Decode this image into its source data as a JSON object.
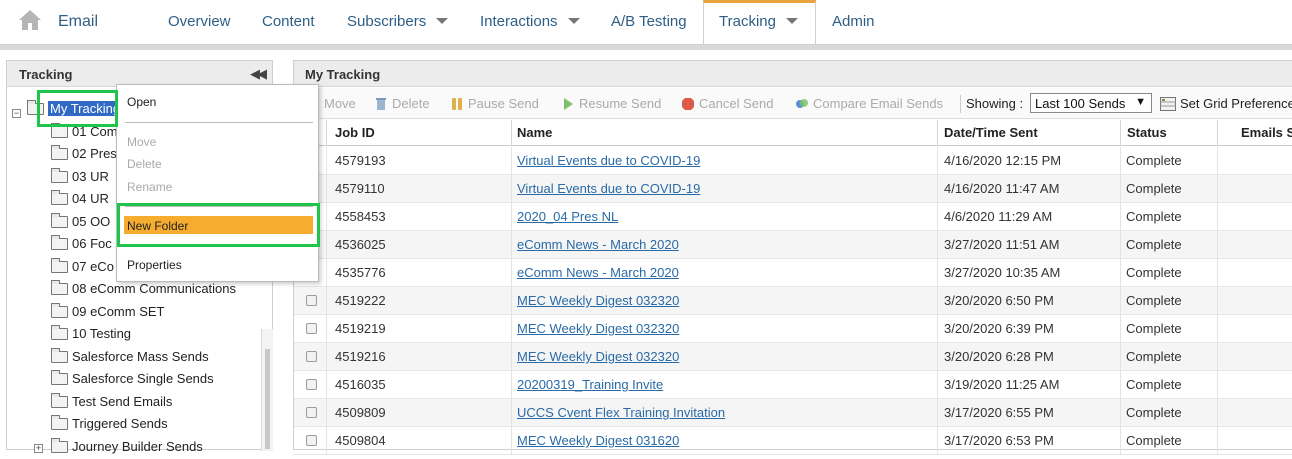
{
  "nav": {
    "app_title": "Email",
    "items": [
      {
        "label": "Overview",
        "has_caret": false
      },
      {
        "label": "Content",
        "has_caret": false
      },
      {
        "label": "Subscribers",
        "has_caret": true
      },
      {
        "label": "Interactions",
        "has_caret": true
      },
      {
        "label": "A/B Testing",
        "has_caret": false
      },
      {
        "label": "Tracking",
        "has_caret": true,
        "active": true
      },
      {
        "label": "Admin",
        "has_caret": false
      }
    ]
  },
  "left": {
    "title": "Tracking",
    "collapse_icon": "double-chevron-left-icon",
    "tree": {
      "root": "My Tracking",
      "folders": [
        "01 Com",
        "02 Pres",
        "03 UR",
        "04 UR",
        "05 OO",
        "06 Foc",
        "07 eCo",
        "08 eComm Communications",
        "09 eComm SET",
        "10 Testing",
        "Salesforce Mass Sends",
        "Salesforce Single Sends",
        "Test Send Emails",
        "Triggered Sends",
        "Journey Builder Sends"
      ]
    }
  },
  "context_menu": {
    "items": [
      {
        "label": "Open",
        "disabled": false
      },
      {
        "label": "Move",
        "disabled": true
      },
      {
        "label": "Delete",
        "disabled": true
      },
      {
        "label": "Rename",
        "disabled": true
      },
      {
        "label": "New Folder",
        "disabled": false,
        "highlighted": true
      },
      {
        "label": "Properties",
        "disabled": false
      }
    ],
    "highlight_color": "#f5ac2f",
    "annotation_color": "#1fc44a"
  },
  "right": {
    "title": "My Tracking",
    "toolbar": {
      "move": "Move",
      "delete": "Delete",
      "pause": "Pause Send",
      "resume": "Resume Send",
      "cancel": "Cancel Send",
      "compare": "Compare Email Sends",
      "showing_label": "Showing :",
      "showing_value": "Last 100 Sends",
      "set_grid": "Set Grid Preferences"
    },
    "columns": [
      "Job ID",
      "Name",
      "Date/Time Sent",
      "Status",
      "Emails Sent"
    ],
    "rows": [
      {
        "job_id": "4579193",
        "name": "Virtual Events due to COVID-19",
        "sent": "4/16/2020 12:15 PM",
        "status": "Complete"
      },
      {
        "job_id": "4579110",
        "name": "Virtual Events due to COVID-19",
        "sent": "4/16/2020 11:47 AM",
        "status": "Complete"
      },
      {
        "job_id": "4558453",
        "name": "2020_04 Pres NL",
        "sent": "4/6/2020 11:29 AM",
        "status": "Complete"
      },
      {
        "job_id": "4536025",
        "name": "eComm News - March 2020",
        "sent": "3/27/2020 11:51 AM",
        "status": "Complete"
      },
      {
        "job_id": "4535776",
        "name": "eComm News - March 2020",
        "sent": "3/27/2020 10:35 AM",
        "status": "Complete"
      },
      {
        "job_id": "4519222",
        "name": "MEC Weekly Digest 032320",
        "sent": "3/20/2020 6:50 PM",
        "status": "Complete"
      },
      {
        "job_id": "4519219",
        "name": "MEC Weekly Digest 032320",
        "sent": "3/20/2020 6:39 PM",
        "status": "Complete"
      },
      {
        "job_id": "4519216",
        "name": "MEC Weekly Digest 032320",
        "sent": "3/20/2020 6:28 PM",
        "status": "Complete"
      },
      {
        "job_id": "4516035",
        "name": "20200319_Training Invite",
        "sent": "3/19/2020 11:25 AM",
        "status": "Complete"
      },
      {
        "job_id": "4509809",
        "name": "UCCS Cvent Flex Training Invitation",
        "sent": "3/17/2020 6:55 PM",
        "status": "Complete"
      },
      {
        "job_id": "4509804",
        "name": "MEC Weekly Digest 031620",
        "sent": "3/17/2020 6:53 PM",
        "status": "Complete"
      }
    ]
  }
}
